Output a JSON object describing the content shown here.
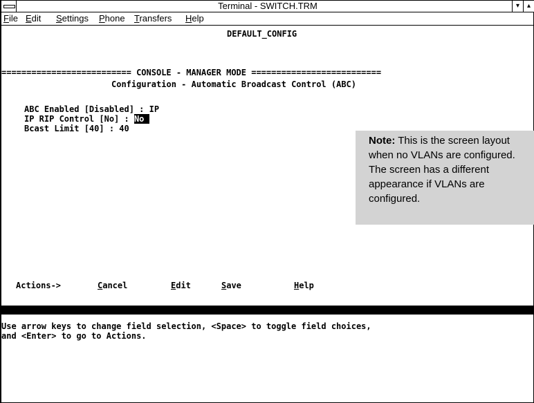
{
  "window": {
    "title": "Terminal - SWITCH.TRM",
    "minimize_glyph": "▾",
    "maximize_glyph": "▴"
  },
  "menu": {
    "items": [
      "File",
      "Edit",
      "Settings",
      "Phone",
      "Transfers",
      "Help"
    ]
  },
  "terminal": {
    "config_name": "DEFAULT_CONFIG",
    "mode_banner": "========================== CONSOLE - MANAGER MODE ==========================",
    "screen_title": "Configuration - Automatic Broadcast Control (ABC)",
    "fields": {
      "abc_enabled": "ABC Enabled [Disabled] : IP",
      "ip_rip_label": "IP RIP Control [No] : ",
      "ip_rip_value": "No ",
      "bcast_limit": "Bcast Limit [40] : 40"
    },
    "actions": {
      "label": "Actions->",
      "cancel": "Cancel",
      "edit": "Edit",
      "save": "Save",
      "help": "Help"
    },
    "help_line_1": "Use arrow keys to change field selection, <Space> to toggle field choices,",
    "help_line_2": "and <Enter> to go to Actions."
  },
  "note": {
    "label": "Note:",
    "text": " This is the screen layout when no VLANs are configured. The screen has a different appearance if VLANs are configured."
  }
}
